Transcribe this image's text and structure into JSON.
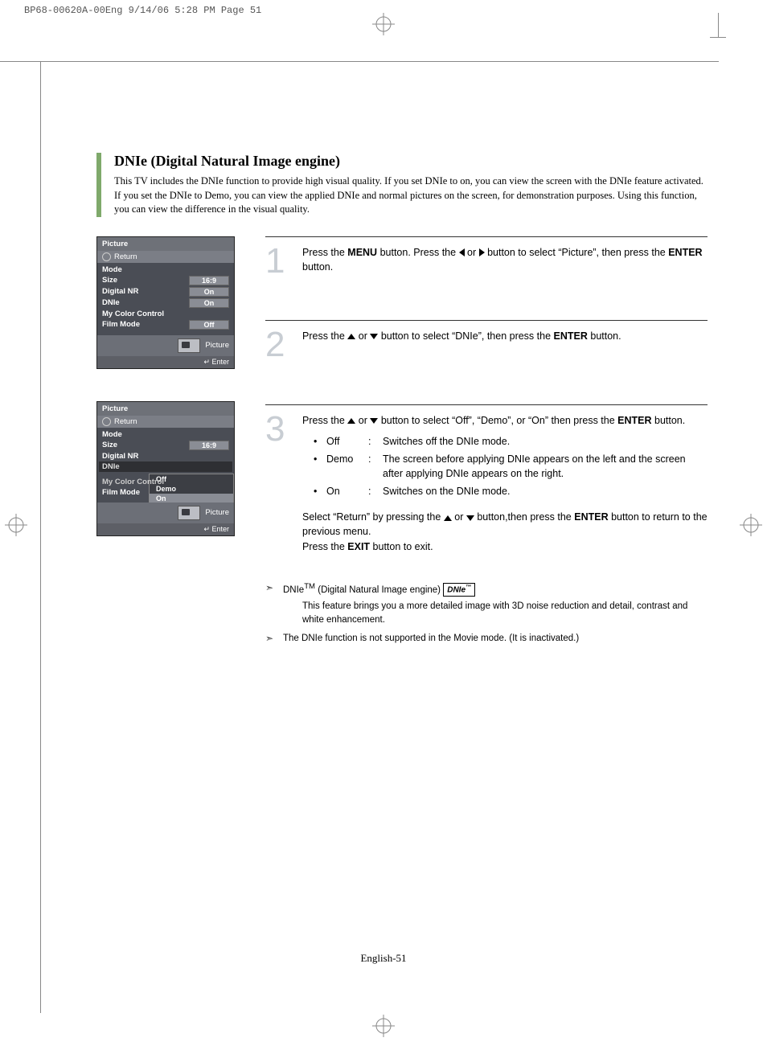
{
  "print_header": "BP68-00620A-00Eng  9/14/06  5:28 PM  Page 51",
  "title": "DNIe (Digital Natural Image engine)",
  "intro": "This TV includes the DNIe function to provide high visual quality. If you set DNIe to on, you can view the screen with the DNIe feature activated. If you set the DNIe to Demo, you can view the applied DNIe and normal pictures on the screen, for demonstration purposes. Using this function, you can view the difference in the visual quality.",
  "osd1": {
    "title": "Picture",
    "return": "Return",
    "rows": {
      "mode": "Mode",
      "size": "Size",
      "size_val": "16:9",
      "dnr": "Digital NR",
      "dnr_val": "On",
      "dnie": "DNIe",
      "dnie_val": "On",
      "mcc": "My Color Control",
      "film": "Film Mode",
      "film_val": "Off"
    },
    "footer_label": "Picture",
    "enter": "Enter"
  },
  "osd2": {
    "title": "Picture",
    "return": "Return",
    "rows": {
      "mode": "Mode",
      "size": "Size",
      "size_val": "16:9",
      "dnr": "Digital NR",
      "dnie": "DNIe",
      "mcc": "My Color Control",
      "film": "Film Mode"
    },
    "submenu": {
      "off": "Off",
      "demo": "Demo",
      "on": "On"
    },
    "footer_label": "Picture",
    "enter": "Enter"
  },
  "steps": {
    "s1": {
      "num": "1",
      "a": "Press the ",
      "menu": "MENU",
      "b": " button. Press the ",
      "c": " or ",
      "d": " button to select “Picture”, then press the ",
      "enter": "ENTER",
      "e": " button."
    },
    "s2": {
      "num": "2",
      "a": "Press the ",
      "b": " or ",
      "c": " button to select “DNIe”, then press the ",
      "enter": "ENTER",
      "d": " button."
    },
    "s3": {
      "num": "3",
      "a": "Press the ",
      "b": " or ",
      "c": " button to select “Off”, “Demo”, or “On” then press the ",
      "enter": "ENTER",
      "d": " button.",
      "opts": {
        "off_l": "Off",
        "off_d": "Switches off the DNIe mode.",
        "demo_l": "Demo",
        "demo_d": "The screen before applying DNIe appears on the left and the screen after applying DNIe appears on the right.",
        "on_l": "On",
        "on_d": "Switches on the DNIe mode."
      },
      "ret1": "Select “Return” by pressing the ",
      "ret2": " or ",
      "ret3": " button,then press the ",
      "ret_enter": "ENTER",
      "ret4": " button to return to the previous menu.",
      "exit1": "Press the ",
      "exit_b": "EXIT",
      "exit2": " button to exit."
    }
  },
  "notes": {
    "n1_label": "DNIe",
    "n1_tm": "TM",
    "n1_rest": " (Digital Natural Image engine) ",
    "n1_badge": "DNIe",
    "n1_detail": "This feature brings you a more detailed image with 3D noise reduction and detail, contrast and white enhancement.",
    "n2": "The DNIe function is not supported in the Movie mode. (It is inactivated.)"
  },
  "page_num": "English-51"
}
